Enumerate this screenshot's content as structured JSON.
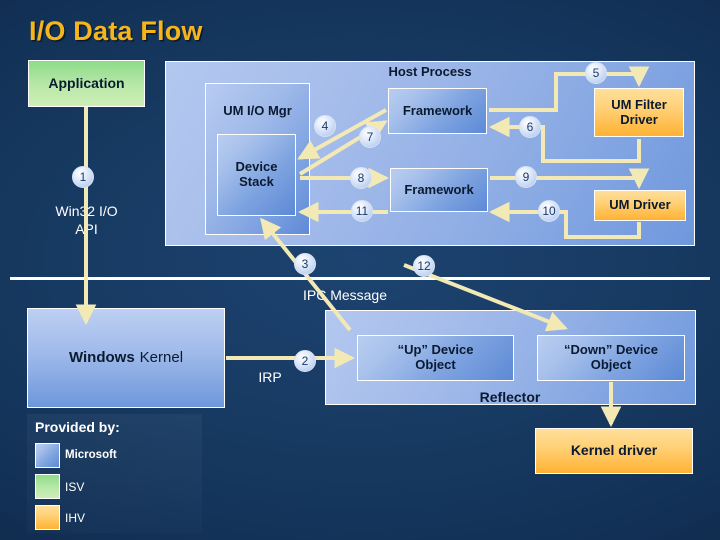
{
  "slide": {
    "title": "I/O Data Flow",
    "title_color": "#f6b61b",
    "background_color": "#123055"
  },
  "boxes": {
    "application": "Application",
    "host_process_label": "Host Process",
    "um_io_mgr": "UM I/O Mgr",
    "device_stack": "Device\nStack",
    "framework_top": "Framework",
    "framework_bottom": "Framework",
    "um_filter_driver": "UM Filter\nDriver",
    "um_driver": "UM Driver",
    "windows_kernel_bold": "Windows",
    "windows_kernel_rest": "Kernel",
    "up_device_object": "“Up” Device\nObject",
    "down_device_object": "“Down” Device\nObject",
    "reflector": "Reflector",
    "kernel_driver": "Kernel driver"
  },
  "labels": {
    "win32_io_api": "Win32 I/O\nAPI",
    "ipc_message": "IPC Message",
    "irp": "IRP"
  },
  "steps": [
    {
      "n": "1"
    },
    {
      "n": "2"
    },
    {
      "n": "3"
    },
    {
      "n": "4"
    },
    {
      "n": "5"
    },
    {
      "n": "6"
    },
    {
      "n": "7"
    },
    {
      "n": "8"
    },
    {
      "n": "9"
    },
    {
      "n": "10"
    },
    {
      "n": "11"
    },
    {
      "n": "12"
    }
  ],
  "legend": {
    "title": "Provided by:",
    "items": [
      {
        "label": "Microsoft",
        "color": "#8fb0e6"
      },
      {
        "label": "ISV",
        "color": "#9adc8c"
      },
      {
        "label": "IHV",
        "color": "#ffcf72"
      }
    ]
  }
}
